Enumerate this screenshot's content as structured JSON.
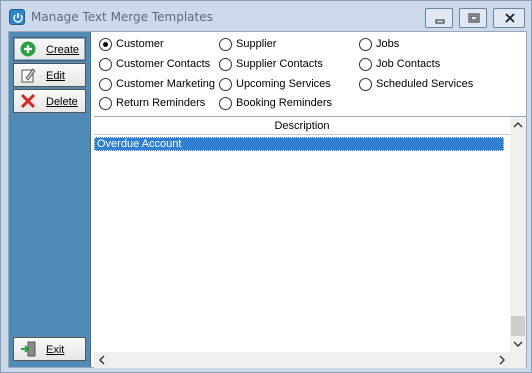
{
  "window": {
    "title": "Manage Text Merge Templates"
  },
  "sidebar": {
    "create_label": "Create",
    "edit_label": "Edit",
    "delete_label": "Delete",
    "exit_label": "Exit"
  },
  "radios": [
    {
      "label": "Customer",
      "selected": true
    },
    {
      "label": "Supplier",
      "selected": false
    },
    {
      "label": "Jobs",
      "selected": false
    },
    {
      "label": "Customer Contacts",
      "selected": false
    },
    {
      "label": "Supplier Contacts",
      "selected": false
    },
    {
      "label": "Job Contacts",
      "selected": false
    },
    {
      "label": "Customer Marketing",
      "selected": false
    },
    {
      "label": "Upcoming Services",
      "selected": false
    },
    {
      "label": "Scheduled Services",
      "selected": false
    },
    {
      "label": "Return Reminders",
      "selected": false
    },
    {
      "label": "Booking Reminders",
      "selected": false
    }
  ],
  "grid": {
    "column_header": "Description",
    "rows": [
      "Overdue Account"
    ]
  },
  "colors": {
    "sidebar_bg": "#4f8bb6",
    "selection": "#2f7fd3",
    "titlebar": "#cbd9ea"
  }
}
